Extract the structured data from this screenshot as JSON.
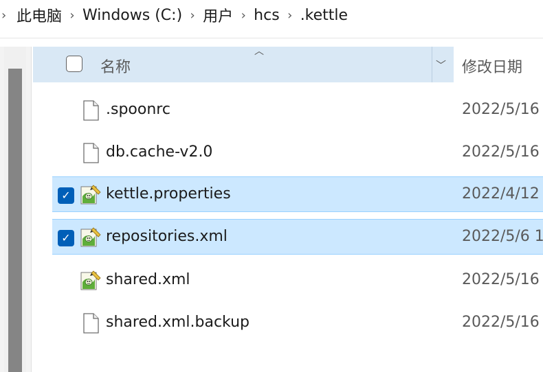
{
  "breadcrumb": {
    "items": [
      "此电脑",
      "Windows (C:)",
      "用户",
      "hcs",
      ".kettle"
    ]
  },
  "header": {
    "name_label": "名称",
    "date_label": "修改日期"
  },
  "files": [
    {
      "name": ".spoonrc",
      "date": "2022/5/16",
      "icon": "document-icon",
      "selected": false
    },
    {
      "name": "db.cache-v2.0",
      "date": "2022/5/16",
      "icon": "document-icon",
      "selected": false
    },
    {
      "name": "kettle.properties",
      "date": "2022/4/12",
      "icon": "kettle-properties-icon",
      "selected": true
    },
    {
      "name": "repositories.xml",
      "date": "2022/5/6 1",
      "icon": "kettle-properties-icon",
      "selected": true
    },
    {
      "name": "shared.xml",
      "date": "2022/5/16",
      "icon": "kettle-properties-icon",
      "selected": false
    },
    {
      "name": "shared.xml.backup",
      "date": "2022/5/16",
      "icon": "document-icon",
      "selected": false
    }
  ],
  "colors": {
    "selection": "#cce8ff",
    "header": "#d9e8f5",
    "checkbox": "#005fb8"
  }
}
